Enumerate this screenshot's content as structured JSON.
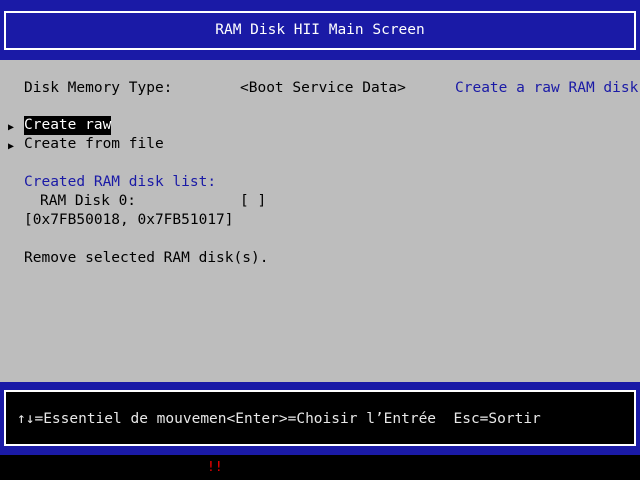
{
  "title": "RAM Disk HII Main Screen",
  "memory_type": {
    "label": "Disk Memory Type:",
    "value": "<Boot Service Data>",
    "help": "Create a raw RAM disk."
  },
  "menu": {
    "arrow": "▶",
    "items": [
      {
        "label": "Create raw",
        "selected": true
      },
      {
        "label": "Create from file",
        "selected": false
      }
    ]
  },
  "ram_list": {
    "header": "Created RAM disk list:",
    "disks": [
      {
        "name": "RAM Disk 0:",
        "checkbox": "[ ]",
        "range": "[0x7FB50018, 0x7FB51017]"
      }
    ]
  },
  "remove_label": "Remove selected RAM disk(s).",
  "footer_help": "↑↓=Essentiel de mouvemen<Enter>=Choisir l’Entrée  Esc=Sortir",
  "bottom_mark": "!!",
  "colors": {
    "frame_blue": "#1a1aa6",
    "panel_gray": "#bdbdbd",
    "help_text_blue": "#1a1aa6",
    "selection": "#000000",
    "warning": "#ff0000"
  }
}
